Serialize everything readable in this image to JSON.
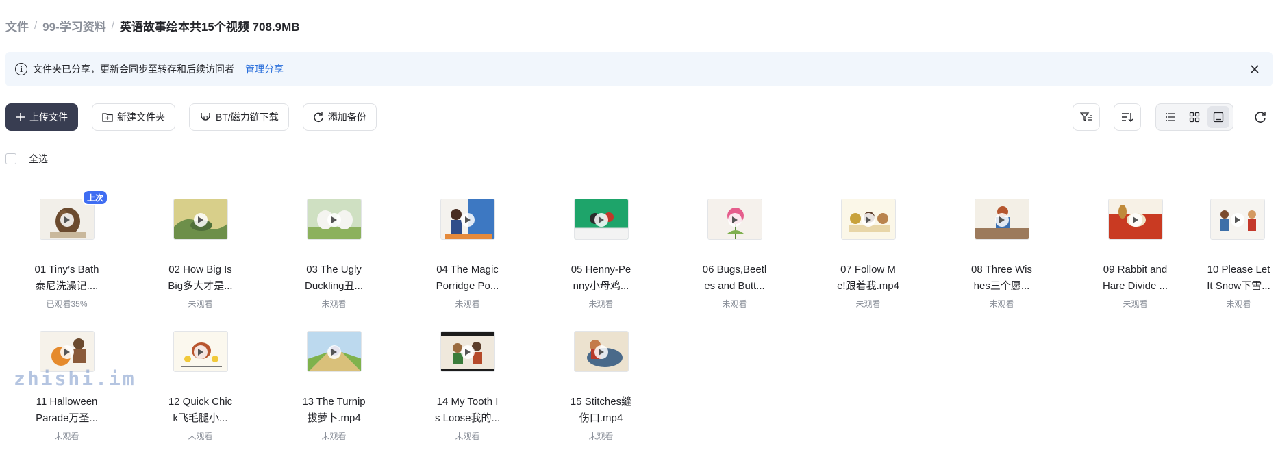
{
  "breadcrumb": {
    "root": "文件",
    "parent": "99-学习资料",
    "current": "英语故事绘本共15个视频 708.9MB"
  },
  "notice": {
    "text": "文件夹已分享，更新会同步至转存和后续访问者",
    "link": "管理分享"
  },
  "toolbar": {
    "upload": "上传文件",
    "new_folder": "新建文件夹",
    "bt_download": "BT/磁力链下载",
    "add_backup": "添加备份"
  },
  "select_all": "全选",
  "files": [
    {
      "line1": "01 Tiny’s Bath",
      "line2": "泰尼洗澡记....",
      "status": "已观看35%",
      "badge": "上次"
    },
    {
      "line1": "02 How Big Is",
      "line2": "Big多大才是...",
      "status": "未观看"
    },
    {
      "line1": "03 The Ugly",
      "line2": "Duckling丑...",
      "status": "未观看"
    },
    {
      "line1": "04 The Magic",
      "line2": "Porridge Po...",
      "status": "未观看"
    },
    {
      "line1": "05 Henny-Pe",
      "line2": "nny小母鸡...",
      "status": "未观看"
    },
    {
      "line1": "06 Bugs,Beetl",
      "line2": "es and Butt...",
      "status": "未观看"
    },
    {
      "line1": "07 Follow M",
      "line2": "e!跟着我.mp4",
      "status": "未观看"
    },
    {
      "line1": "08 Three Wis",
      "line2": "hes三个愿...",
      "status": "未观看"
    },
    {
      "line1": "09 Rabbit and",
      "line2": "Hare Divide ...",
      "status": "未观看"
    },
    {
      "line1": "10 Please Let",
      "line2": "It Snow下雪...",
      "status": "未观看"
    },
    {
      "line1": "11 Halloween",
      "line2": "Parade万圣...",
      "status": "未观看"
    },
    {
      "line1": "12 Quick Chic",
      "line2": "k飞毛腿小...",
      "status": "未观看"
    },
    {
      "line1": "13 The Turnip",
      "line2": "拔萝卜.mp4",
      "status": "未观看"
    },
    {
      "line1": "14 My Tooth I",
      "line2": "s Loose我的...",
      "status": "未观看"
    },
    {
      "line1": "15 Stitches缝",
      "line2": "伤口.mp4",
      "status": "未观看"
    }
  ],
  "watermark": "zhishi.im",
  "colors": {
    "primary_button": "#383d51",
    "link": "#2a6fdb",
    "notice_bg": "#f1f6fc",
    "badge": "#3f6df2",
    "muted_text": "#8a8f99"
  },
  "icons": {
    "upload": "plus-icon",
    "new_folder": "folder-plus-icon",
    "bt": "bt-icon",
    "backup": "sync-icon",
    "filter": "filter-icon",
    "sort": "sort-icon",
    "list_view": "list-icon",
    "grid_view": "grid-icon",
    "large_view": "thumbnail-icon",
    "refresh": "refresh-icon"
  }
}
